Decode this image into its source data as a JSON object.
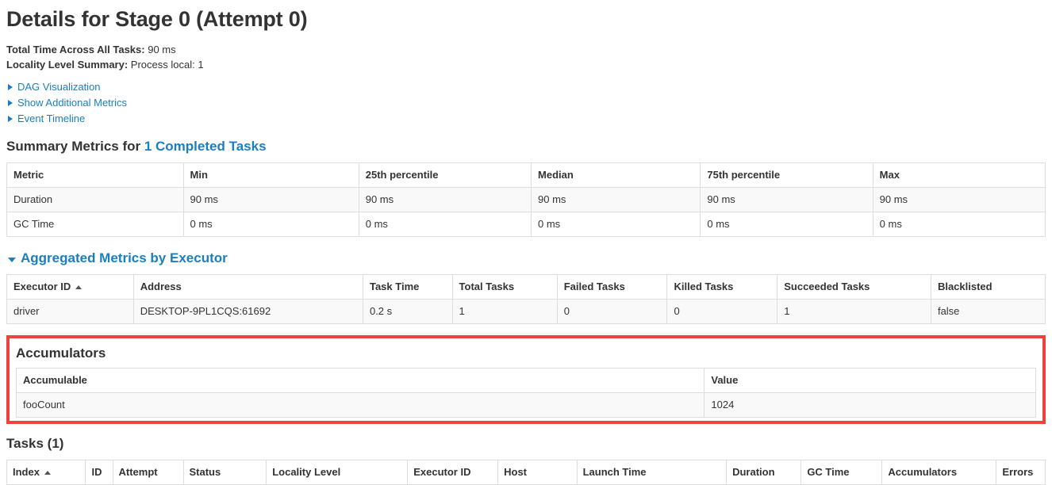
{
  "page": {
    "title": "Details for Stage 0 (Attempt 0)",
    "total_time_label": "Total Time Across All Tasks:",
    "total_time_value": "90 ms",
    "locality_label": "Locality Level Summary:",
    "locality_value": "Process local: 1"
  },
  "toggles": [
    {
      "label": "DAG Visualization",
      "icon": "caret-right-icon",
      "expanded": false
    },
    {
      "label": "Show Additional Metrics",
      "icon": "caret-right-icon",
      "expanded": false
    },
    {
      "label": "Event Timeline",
      "icon": "caret-right-icon",
      "expanded": false
    }
  ],
  "summary_metrics": {
    "heading_prefix": "Summary Metrics for ",
    "heading_link": "1 Completed Tasks",
    "columns": [
      "Metric",
      "Min",
      "25th percentile",
      "Median",
      "75th percentile",
      "Max"
    ],
    "rows": [
      [
        "Duration",
        "90 ms",
        "90 ms",
        "90 ms",
        "90 ms",
        "90 ms"
      ],
      [
        "GC Time",
        "0 ms",
        "0 ms",
        "0 ms",
        "0 ms",
        "0 ms"
      ]
    ]
  },
  "aggregated_metrics": {
    "heading": "Aggregated Metrics by Executor",
    "icon": "caret-down-icon",
    "columns": [
      "Executor ID",
      "Address",
      "Task Time",
      "Total Tasks",
      "Failed Tasks",
      "Killed Tasks",
      "Succeeded Tasks",
      "Blacklisted"
    ],
    "sorted_column": "Executor ID",
    "sort_direction": "asc",
    "rows": [
      [
        "driver",
        "DESKTOP-9PL1CQS:61692",
        "0.2 s",
        "1",
        "0",
        "0",
        "1",
        "false"
      ]
    ]
  },
  "accumulators": {
    "heading": "Accumulators",
    "highlight_color": "#f0423c",
    "columns": [
      "Accumulable",
      "Value"
    ],
    "rows": [
      [
        "fooCount",
        "1024"
      ]
    ]
  },
  "tasks": {
    "heading": "Tasks (1)",
    "columns": [
      "Index",
      "ID",
      "Attempt",
      "Status",
      "Locality Level",
      "Executor ID",
      "Host",
      "Launch Time",
      "Duration",
      "GC Time",
      "Accumulators",
      "Errors"
    ],
    "sorted_column": "Index",
    "sort_direction": "asc",
    "rows": []
  },
  "colors": {
    "link": "#1a7fc1",
    "text": "#333333",
    "border": "#dddddd",
    "row_odd": "#f9f9f9",
    "highlight": "#f0423c"
  }
}
